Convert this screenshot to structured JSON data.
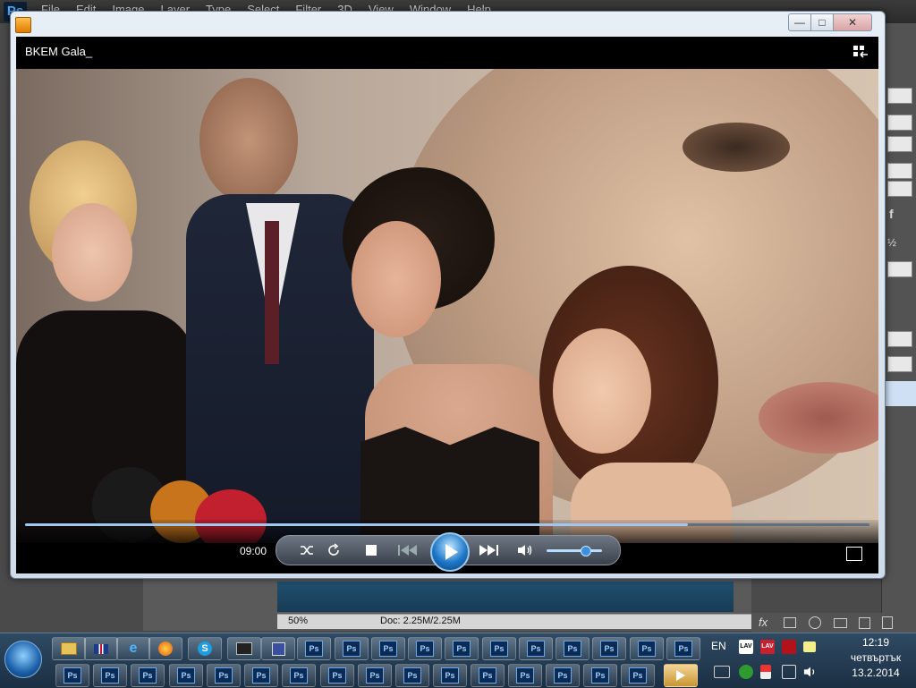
{
  "photoshop": {
    "logo": "Ps",
    "menu": [
      "File",
      "Edit",
      "Image",
      "Layer",
      "Type",
      "Select",
      "Filter",
      "3D",
      "View",
      "Window",
      "Help"
    ],
    "status": {
      "zoom": "50%",
      "doc": "Doc: 2.25M/2.25M"
    },
    "panel_glyphs": {
      "f": "f",
      "half": "½",
      "fx": "fx"
    }
  },
  "player": {
    "media_title": "BKEM Gala_",
    "time": "09:00",
    "progress": 0.785,
    "volume": 0.7,
    "window_buttons": {
      "minimize": "—",
      "maximize": "□",
      "close": "✕"
    }
  },
  "taskbar": {
    "language": "EN",
    "clock": {
      "time": "12:19",
      "day": "четвъртък",
      "date": "13.2.2014"
    },
    "ps_label": "Ps",
    "tray_labels": {
      "lav1": "LAV",
      "lav2": "LAV"
    }
  },
  "colors": {
    "accent": "#1d78c8",
    "taskbar": "#1b2f43"
  }
}
